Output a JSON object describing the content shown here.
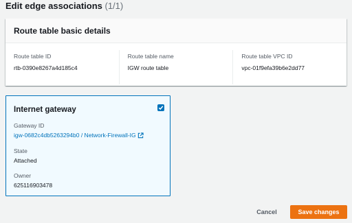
{
  "header": {
    "title": "Edit edge associations",
    "count": "(1/1)"
  },
  "route_table": {
    "heading": "Route table basic details",
    "fields": [
      {
        "label": "Route table ID",
        "value": "rtb-0390e8267a4d185c4"
      },
      {
        "label": "Route table name",
        "value": "IGW route table"
      },
      {
        "label": "Route table VPC ID",
        "value": "vpc-01f9efa39b6e2dd77"
      }
    ]
  },
  "gateway": {
    "title": "Internet gateway",
    "checked": true,
    "id_label": "Gateway ID",
    "id_link": "igw-0682c4db5263294b0 / Network-Firewall-IG",
    "state_label": "State",
    "state_value": "Attached",
    "owner_label": "Owner",
    "owner_value": "625116903478"
  },
  "footer": {
    "cancel_label": "Cancel",
    "save_label": "Save changes"
  },
  "colors": {
    "accent": "#0073bb",
    "primary_button": "#ec7211",
    "selected_card_bg": "#f1faff"
  },
  "icons": {
    "checkbox": "checkbox-checked-icon",
    "external_link": "external-link-icon"
  }
}
